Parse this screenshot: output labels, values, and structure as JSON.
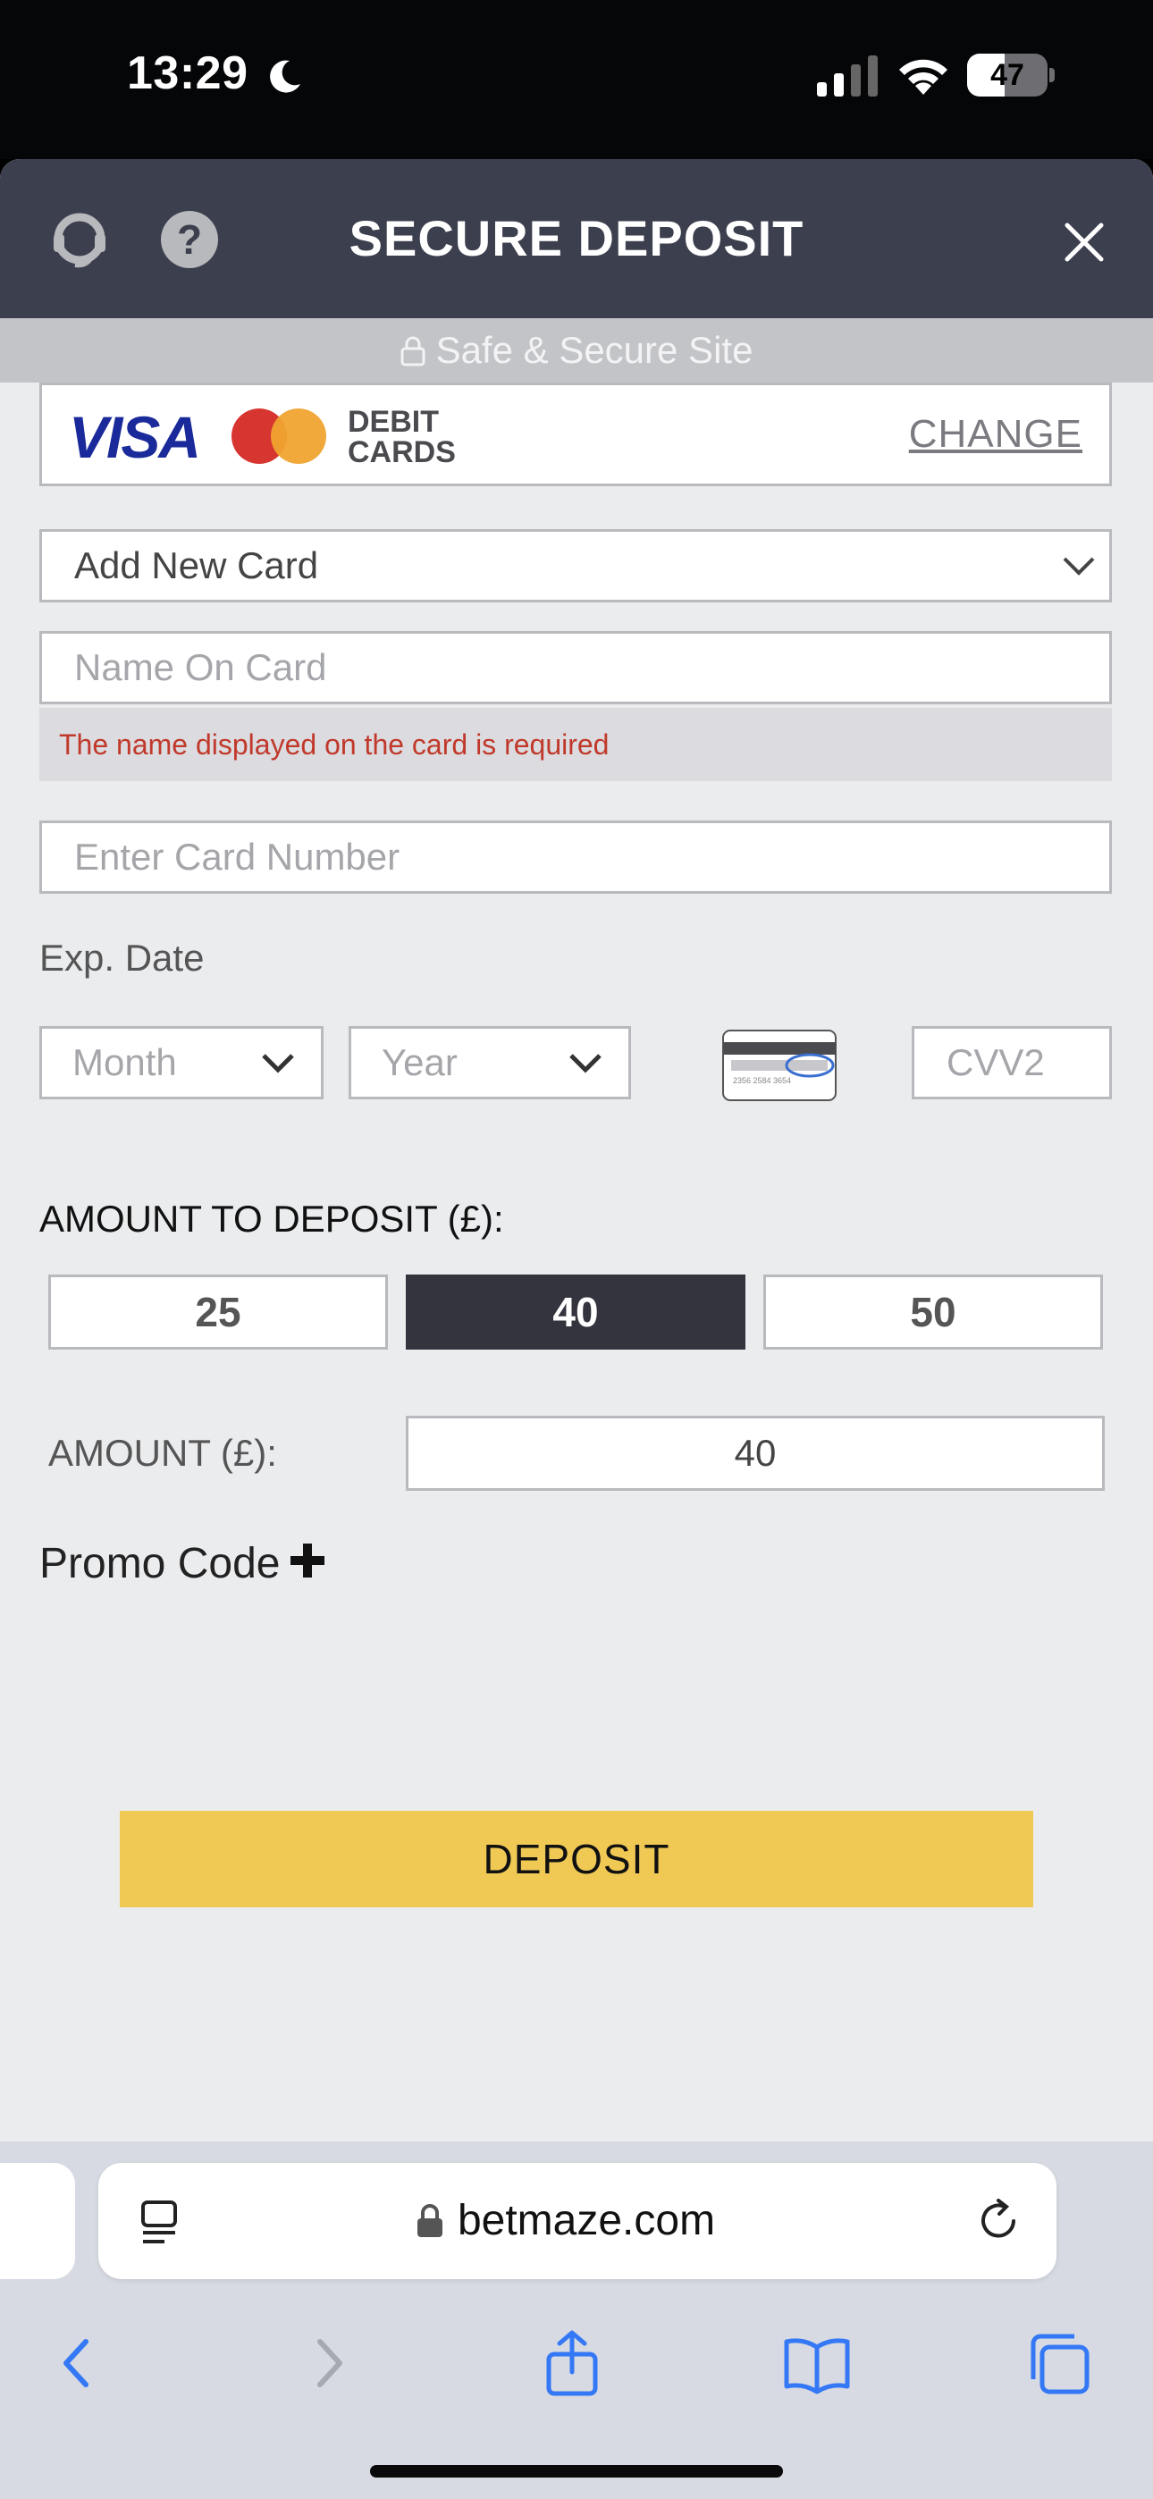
{
  "status_bar": {
    "time": "13:29",
    "battery": "47",
    "battery_level": 0.47
  },
  "modal": {
    "title": "SECURE DEPOSIT",
    "secure_banner": "Safe & Secure Site",
    "card_brands": {
      "visa": "VISA",
      "debit_line1": "DEBIT",
      "debit_line2": "CARDS",
      "change_label": "CHANGE"
    },
    "card_select": {
      "value": "Add New Card"
    },
    "name_field": {
      "placeholder": "Name On Card",
      "error": "The name displayed on the card is required"
    },
    "card_number_field": {
      "placeholder": "Enter Card Number"
    },
    "exp_label": "Exp. Date",
    "month_select": {
      "value": "Month"
    },
    "year_select": {
      "value": "Year"
    },
    "cvv_field": {
      "placeholder": "CVV2"
    },
    "amount_heading": "AMOUNT TO DEPOSIT (£):",
    "amount_options": [
      {
        "label": "25",
        "selected": false
      },
      {
        "label": "40",
        "selected": true
      },
      {
        "label": "50",
        "selected": false
      }
    ],
    "amount_label": "AMOUNT (£):",
    "amount_value": "40",
    "promo_label": "Promo Code",
    "deposit_label": "DEPOSIT"
  },
  "browser": {
    "url": "betmaze.com"
  },
  "colors": {
    "header": "#3c3f4d",
    "deposit_button": "#f0c955",
    "error_text": "#c0392b",
    "selected_amount": "#33343e"
  }
}
